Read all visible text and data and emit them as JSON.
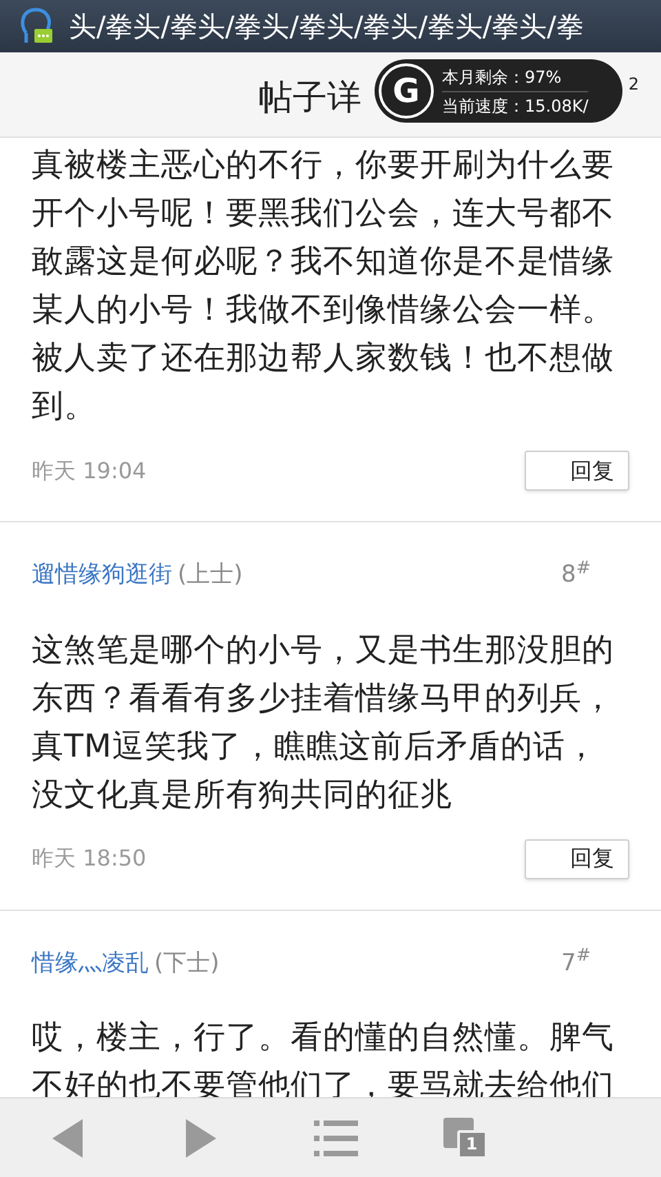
{
  "status_bar": {
    "ticker": "头/拳头/拳头/拳头/拳头/拳头/拳头/拳头/拳"
  },
  "title_bar": {
    "title": "帖子详",
    "counter": "2"
  },
  "traffic_widget": {
    "logo": "G",
    "remaining": "本月剩余：97%",
    "speed": "当前速度：15.08K/"
  },
  "posts": [
    {
      "body": "真被楼主恶心的不行，你要开刷为什么要开个小号呢！要黑我们公会，连大号都不敢露这是何必呢？我不知道你是不是惜缘某人的小号！我做不到像惜缘公会一样。被人卖了还在那边帮人家数钱！也不想做到。",
      "time": "昨天 19:04",
      "reply": "回复"
    },
    {
      "author": "遛惜缘狗逛街",
      "rank": "(上士)",
      "floor": "8$^{#}$",
      "body": "这煞笔是哪个的小号，又是书生那没胆的东西？看看有多少挂着惜缘马甲的列兵，真TM逗笑我了，瞧瞧这前后矛盾的话，没文化真是所有狗共同的征兆",
      "time": "昨天 18:50",
      "reply": "回复"
    },
    {
      "author": "惜缘灬凌乱",
      "rank": "(下士)",
      "floor": "7$^{#}$",
      "body": "哎，楼主，行了。看的懂的自然懂。脾气不好的也不要管他们了，要骂就去给他们"
    }
  ],
  "bottom_bar": {
    "tabs_count": "1"
  }
}
